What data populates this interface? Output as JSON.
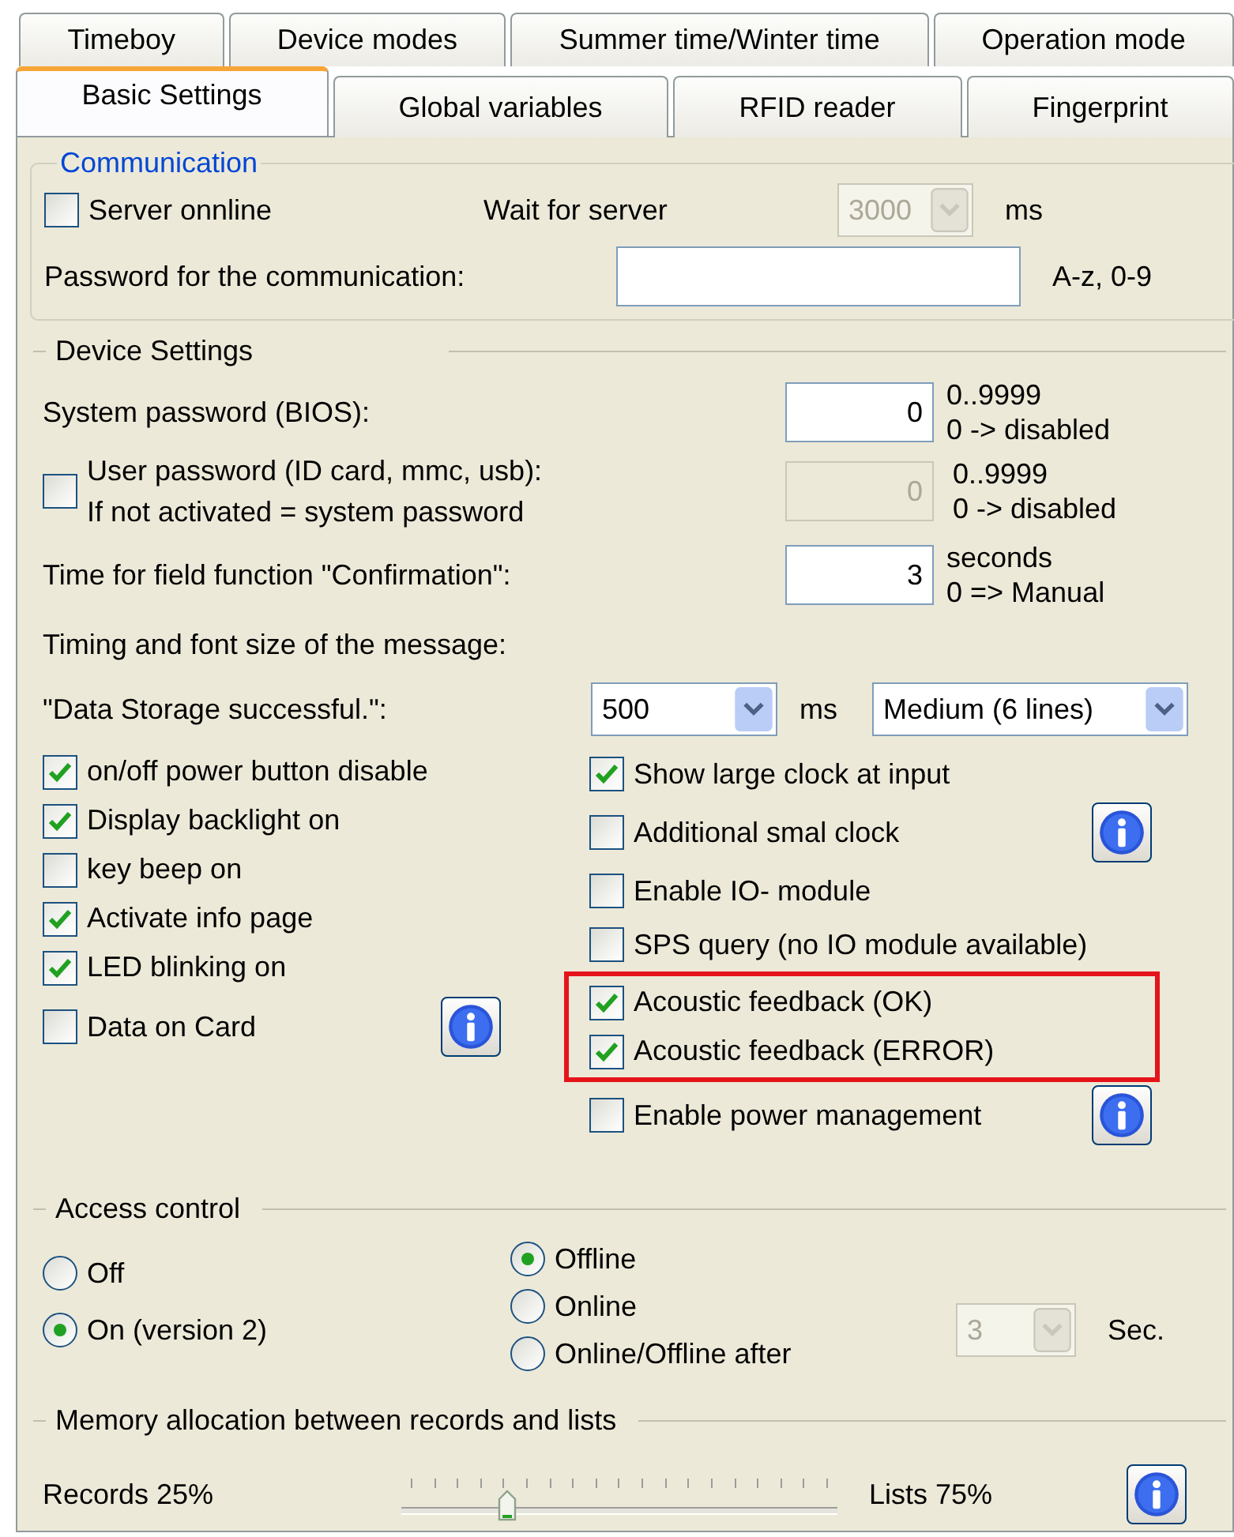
{
  "tabs_row_1": [
    {
      "label": "Timeboy",
      "selected": false
    },
    {
      "label": "Device modes",
      "selected": false
    },
    {
      "label": "Summer time/Winter time",
      "selected": false
    },
    {
      "label": "Operation mode",
      "selected": false
    }
  ],
  "tabs_row_2": [
    {
      "label": "Basic Settings",
      "selected": true
    },
    {
      "label": "Global variables",
      "selected": false
    },
    {
      "label": "RFID reader",
      "selected": false
    },
    {
      "label": "Fingerprint",
      "selected": false
    }
  ],
  "communication": {
    "title": "Communication",
    "server_online": {
      "label": "Server onnline",
      "checked": false
    },
    "wait_label": "Wait for server",
    "wait_combo": {
      "value": "3000",
      "disabled": true
    },
    "wait_unit": "ms",
    "password_label": "Password for the communication:",
    "password_hint": "A-z, 0-9"
  },
  "device_settings": {
    "title": "Device Settings",
    "system_password": {
      "label": "System password (BIOS):",
      "value": "0",
      "disabled": false,
      "hints": [
        "0..9999",
        "0 -> disabled"
      ]
    },
    "user_password": {
      "checked": false,
      "label_lines": [
        "User password (ID card, mmc, usb):",
        "If not activated = system password"
      ],
      "value": "0",
      "disabled": true,
      "hints": [
        "0..9999",
        "0 -> disabled"
      ]
    },
    "confirmation": {
      "label": "Time for field function \"Confirmation\":",
      "value": "3",
      "disabled": false,
      "hints": [
        "seconds",
        "0 => Manual"
      ]
    },
    "timing_label": "Timing and font size of the message:",
    "data_storage": {
      "label": "\"Data Storage successful.\":",
      "time_value": "500",
      "unit": "ms",
      "size_value": "Medium (6 lines)"
    },
    "left_options": [
      {
        "label": "on/off power button disable",
        "checked": true,
        "info": false
      },
      {
        "label": "Display backlight on",
        "checked": true,
        "info": false
      },
      {
        "label": "key beep on",
        "checked": false,
        "info": false
      },
      {
        "label": "Activate info page",
        "checked": true,
        "info": false
      },
      {
        "label": "LED blinking on",
        "checked": true,
        "info": false
      },
      {
        "label": "Data on Card",
        "checked": false,
        "info": true
      }
    ],
    "right_options": [
      {
        "label": "Show large clock at input",
        "checked": true,
        "info": false,
        "highlighted": false
      },
      {
        "label": "Additional smal clock",
        "checked": false,
        "info": true,
        "highlighted": false
      },
      {
        "label": "Enable IO- module",
        "checked": false,
        "info": false,
        "highlighted": false
      },
      {
        "label": "SPS query (no IO module available)",
        "checked": false,
        "info": false,
        "highlighted": false
      },
      {
        "label": "Acoustic feedback (OK)",
        "checked": true,
        "info": false,
        "highlighted": true
      },
      {
        "label": "Acoustic feedback (ERROR)",
        "checked": true,
        "info": false,
        "highlighted": true
      },
      {
        "label": "Enable power management",
        "checked": false,
        "info": true,
        "highlighted": false
      }
    ]
  },
  "access_control": {
    "title": "Access control",
    "state_options": [
      {
        "label": "Off",
        "selected": false
      },
      {
        "label": "On (version 2)",
        "selected": true
      }
    ],
    "mode_options": [
      {
        "label": "Offline",
        "selected": true
      },
      {
        "label": "Online",
        "selected": false
      },
      {
        "label": "Online/Offline after",
        "selected": false
      }
    ],
    "delay_combo": {
      "value": "3",
      "disabled": true
    },
    "delay_unit": "Sec."
  },
  "memory": {
    "title": "Memory allocation between records and lists",
    "left_label": "Records 25%",
    "level": 0.22,
    "right_label": "Lists 75%",
    "info": true
  }
}
